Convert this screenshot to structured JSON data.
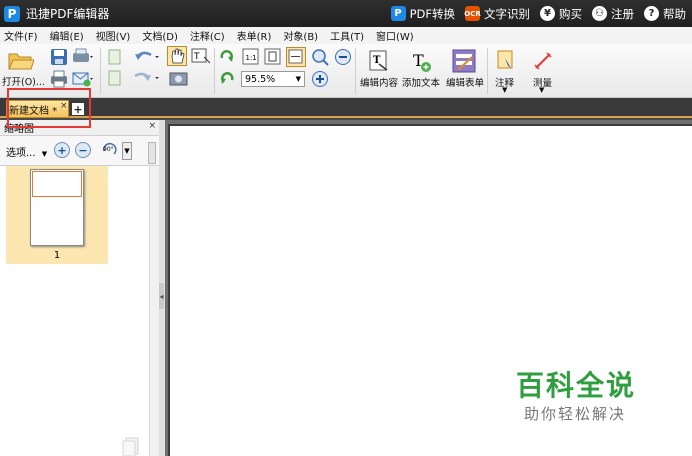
{
  "window": {
    "app_title": "迅捷PDF编辑器",
    "logo_letter": "P",
    "actions": [
      {
        "label": "PDF转换",
        "icon": "pdf-convert-icon",
        "glyph": "P"
      },
      {
        "label": "文字识别",
        "icon": "ocr-icon",
        "glyph": "OCR"
      },
      {
        "label": "购买",
        "icon": "yen-icon",
        "glyph": "¥"
      },
      {
        "label": "注册",
        "icon": "user-icon",
        "glyph": "⚇"
      },
      {
        "label": "帮助",
        "icon": "help-icon",
        "glyph": "?"
      }
    ]
  },
  "menu": [
    "文件(F)",
    "编辑(E)",
    "视图(V)",
    "文档(D)",
    "注释(C)",
    "表单(R)",
    "对象(B)",
    "工具(T)",
    "窗口(W)"
  ],
  "toolbar": {
    "open_label": "打开(O)...",
    "zoom_value": "95.5%",
    "edit_content_label": "编辑内容",
    "add_text_label": "添加文本",
    "edit_form_label": "编辑表单",
    "annotate_label": "注释",
    "measure_label": "测量"
  },
  "tabs": {
    "doc_tab_label": "新建文档 *",
    "close_glyph": "×",
    "add_glyph": "+"
  },
  "thumbnails": {
    "panel_title": "缩略图",
    "close_glyph": "×",
    "options_label": "选项...",
    "rotate_label": "90°",
    "pages": [
      "1"
    ]
  },
  "watermark": {
    "title": "百科全说",
    "subtitle": "助你轻松解决"
  },
  "colors": {
    "tab_active": "#f5c25c",
    "highlight_box": "#e53935",
    "watermark_green": "#2e9e3e"
  }
}
